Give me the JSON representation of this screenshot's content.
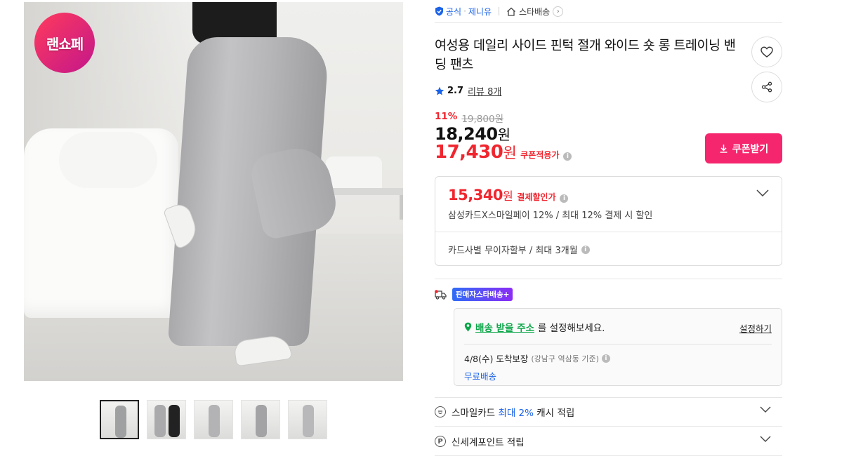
{
  "image": {
    "badge_text": "랜쇼페",
    "thumbnail_count": 5
  },
  "header": {
    "official_label": "공식",
    "brand_name": "제니유",
    "star_delivery_label": "스타배송"
  },
  "product": {
    "title": "여성용 데일리 사이드 핀턱 절개 와이드 숏 롱 트레이닝 밴딩 팬츠",
    "rating": "2.7",
    "review_label": "리뷰 8개"
  },
  "pricing": {
    "discount_rate": "11%",
    "original_price": "19,800원",
    "price_value": "18,240",
    "price_unit": "원",
    "coupon_price_value": "17,430",
    "coupon_price_unit": "원",
    "coupon_applied_label": "쿠폰적용가",
    "coupon_button_label": "쿠폰받기"
  },
  "payment": {
    "pay_price_value": "15,340",
    "pay_price_unit": "원",
    "pay_label": "결제할인가",
    "card_desc": "삼성카드X스마일페이 12% / 최대 12% 결제 시 할인",
    "installment_desc": "카드사별 무이자할부 / 최대 3개월"
  },
  "shipping": {
    "star_tag": "판매자스타배송+",
    "address_link": "배송 받을 주소",
    "address_suffix": "를 설정해보세요.",
    "set_link": "설정하기",
    "arrival_date": "4/8(수) 도착보장",
    "arrival_basis": "(강남구 역삼동 기준)",
    "free_shipping": "무료배송"
  },
  "benefits": {
    "smile_prefix": "스마일카드",
    "smile_highlight": "최대 2%",
    "smile_suffix": "캐시 적립",
    "shinsegae_label": "신세계포인트 적립"
  },
  "colors": {
    "accent_red": "#f0262f",
    "coupon_pink": "#f5266d",
    "link_blue": "#1a62e8",
    "green": "#0aa648"
  }
}
